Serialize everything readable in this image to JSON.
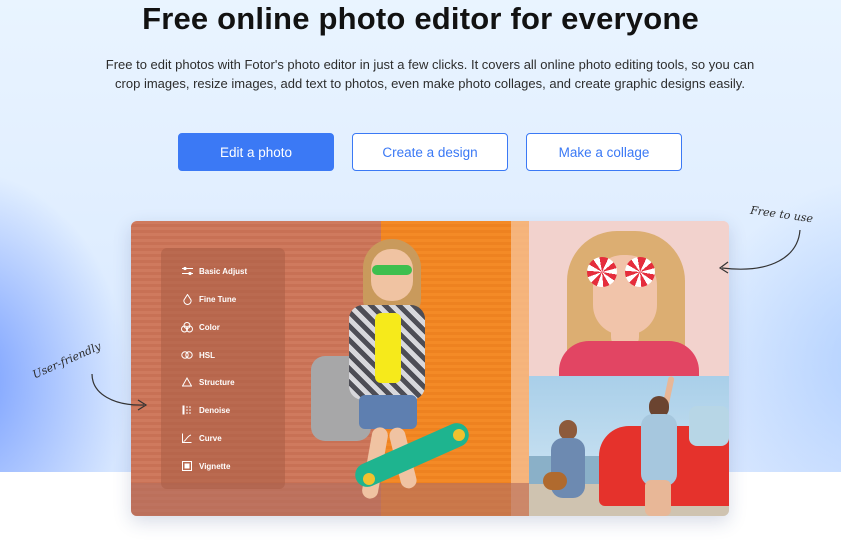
{
  "hero": {
    "title": "Free online photo editor for everyone",
    "subtitle": "Free to edit photos with Fotor's photo editor in just a few clicks. It covers all online photo editing tools, so you can crop images, resize images, add text to photos, even make photo collages, and create graphic designs easily."
  },
  "buttons": {
    "edit": "Edit a photo",
    "design": "Create a design",
    "collage": "Make a collage"
  },
  "panel": {
    "items": [
      {
        "label": "Basic Adjust",
        "icon": "sliders-icon"
      },
      {
        "label": "Fine Tune",
        "icon": "droplet-icon"
      },
      {
        "label": "Color",
        "icon": "color-circles-icon"
      },
      {
        "label": "HSL",
        "icon": "hsl-icon"
      },
      {
        "label": "Structure",
        "icon": "triangle-icon"
      },
      {
        "label": "Denoise",
        "icon": "denoise-icon"
      },
      {
        "label": "Curve",
        "icon": "curve-icon"
      },
      {
        "label": "Vignette",
        "icon": "vignette-icon"
      }
    ]
  },
  "annotations": {
    "free_to_use": "Free to use",
    "user_friendly": "User-friendly"
  },
  "colors": {
    "accent": "#3b79f5",
    "title": "#121212"
  }
}
